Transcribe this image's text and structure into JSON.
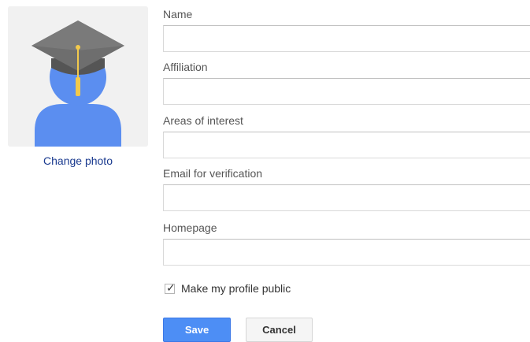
{
  "avatar": {
    "icon": "graduate-avatar-icon",
    "change_photo_label": "Change photo"
  },
  "form": {
    "name": {
      "label": "Name",
      "value": ""
    },
    "affiliation": {
      "label": "Affiliation",
      "value": ""
    },
    "areas_of_interest": {
      "label": "Areas of interest",
      "value": ""
    },
    "email": {
      "label": "Email for verification",
      "value": ""
    },
    "homepage": {
      "label": "Homepage",
      "value": ""
    }
  },
  "public_profile": {
    "label": "Make my profile public",
    "checked": true
  },
  "buttons": {
    "save_label": "Save",
    "cancel_label": "Cancel"
  },
  "colors": {
    "accent": "#4d8ef5",
    "link": "#1a3a8f",
    "avatar_body": "#5b8ef0",
    "cap": "#666666",
    "tassel": "#f2c94c"
  }
}
